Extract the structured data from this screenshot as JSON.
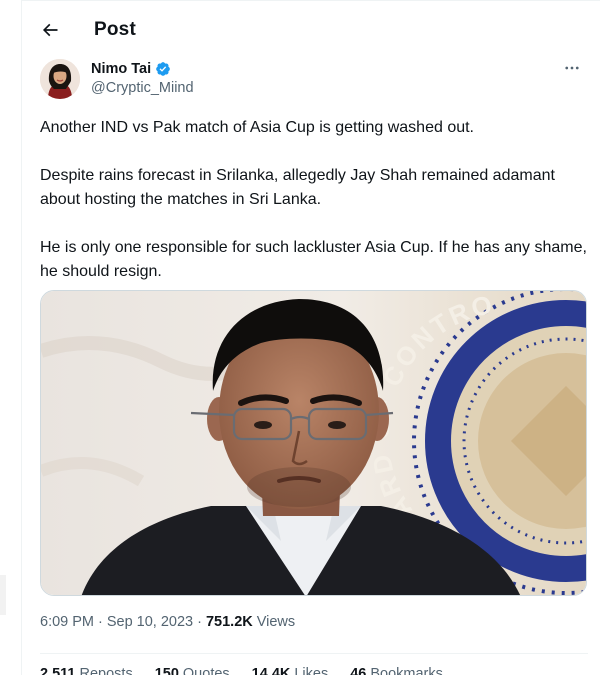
{
  "header": {
    "title": "Post"
  },
  "author": {
    "display_name": "Nimo Tai",
    "handle": "@Cryptic_Miind",
    "verified": true
  },
  "tweet": {
    "paragraphs": [
      "Another IND vs Pak match of Asia Cup is getting washed out.",
      "Despite rains forecast in Srilanka, allegedly Jay Shah remained adamant about hosting the matches in Sri Lanka.",
      "He is only one responsible for such lackluster Asia Cup. If he has any shame, he should resign."
    ],
    "media": {
      "seal_text": "BOARD OF CONTRO"
    }
  },
  "meta": {
    "time": "6:09 PM",
    "separator": "·",
    "date": "Sep 10, 2023",
    "views_count": "751.2K",
    "views_label": "Views"
  },
  "stats": [
    {
      "count": "2,511",
      "label": "Reposts"
    },
    {
      "count": "150",
      "label": "Quotes"
    },
    {
      "count": "14.4K",
      "label": "Likes"
    },
    {
      "count": "46",
      "label": "Bookmarks"
    }
  ],
  "colors": {
    "text_primary": "#0f1419",
    "text_secondary": "#536471",
    "verified_blue": "#1d9bf0",
    "border": "#eff3f4",
    "seal_blue": "#2a3a8f"
  },
  "icons": {
    "back": "arrow-left-icon",
    "verified": "verified-badge-icon",
    "more": "more-horizontal-icon"
  }
}
